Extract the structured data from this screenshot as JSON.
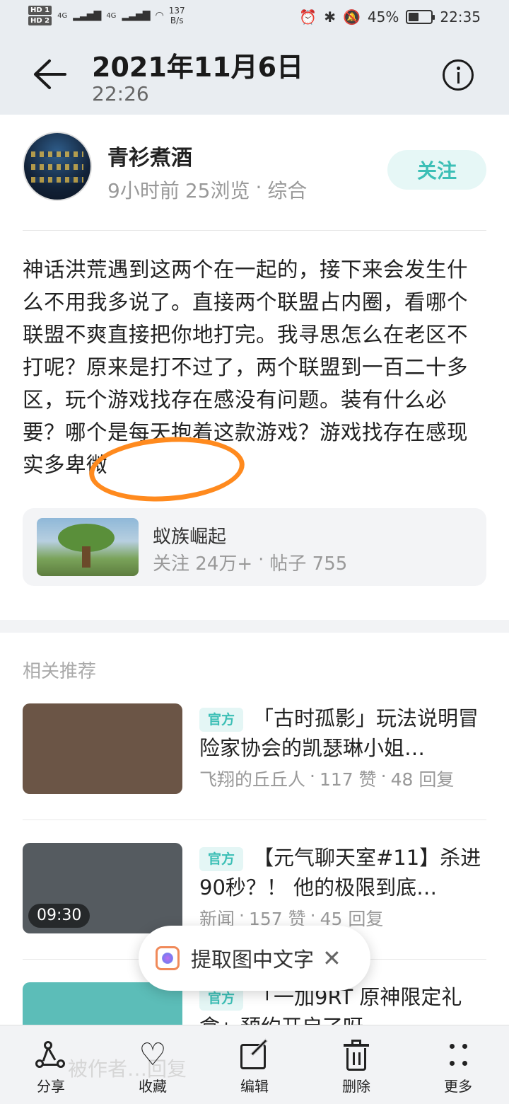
{
  "status_bar": {
    "hd1": "HD 1",
    "hd2": "HD 2",
    "net1": "4G",
    "net2": "4G",
    "speed_value": "137",
    "speed_unit": "B/s",
    "battery": "45%",
    "time": "22:35"
  },
  "header": {
    "title": "2021年11月6日",
    "time": "22:26"
  },
  "post": {
    "author": "青衫煮酒",
    "time_ago": "9小时前",
    "views": "25浏览",
    "dot": "·",
    "category": "综合",
    "follow_label": "关注",
    "content": "神话洪荒遇到这两个在一起的，接下来会发生什么不用我多说了。直接两个联盟占内圈，看哪个联盟不爽直接把你地打完。我寻思怎么在老区不打呢？原来是打不过了，两个联盟到一百二十多区，玩个游戏找存在感没有问题。装有什么必要？哪个是每天抱着这款游戏？游戏找存在感现实多卑微",
    "topic": {
      "name": "蚁族崛起",
      "followers": "关注 24万+",
      "dot": "·",
      "posts": "帖子 755"
    }
  },
  "related": {
    "title": "相关推荐",
    "items": [
      {
        "badge": "官方",
        "title": "「古时孤影」玩法说明冒险家协会的凯瑟琳小姐…",
        "author": "飞翔的丘丘人",
        "likes": "117 赞",
        "replies": "48 回复",
        "dot": "·",
        "thumb_color": "#6b5546",
        "duration": ""
      },
      {
        "badge": "官方",
        "title": "【元气聊天室#11】杀进90秒？！ 他的极限到底…",
        "author": "新闻",
        "likes": "157 赞",
        "replies": "45 回复",
        "dot": "·",
        "thumb_color": "#555b60",
        "duration": "09:30"
      },
      {
        "badge": "官方",
        "title": "「一加9RT 原神限定礼盒」预约开启了呀",
        "author": "",
        "likes": "",
        "replies": "",
        "dot": "",
        "thumb_color": "#5cbdb8",
        "duration": ""
      }
    ]
  },
  "toast": {
    "label": "提取图中文字",
    "close": "✕"
  },
  "bottom_bar": {
    "ghost_text": "被作者…回复",
    "share": "分享",
    "favorite": "收藏",
    "edit": "编辑",
    "delete": "删除",
    "more": "更多"
  },
  "colors": {
    "accent": "#3cbfb6",
    "highlight": "#ff8a1e"
  }
}
